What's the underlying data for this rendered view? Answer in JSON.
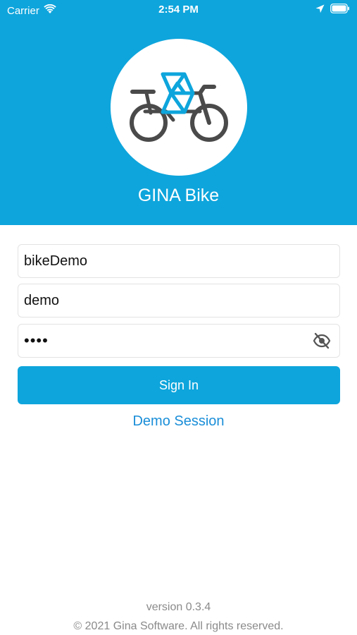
{
  "status_bar": {
    "carrier": "Carrier",
    "time": "2:54 PM"
  },
  "app": {
    "title": "GINA Bike"
  },
  "form": {
    "username_value": "bikeDemo",
    "second_value": "demo",
    "password_value": "demo"
  },
  "actions": {
    "sign_in_label": "Sign In",
    "demo_session_label": "Demo Session"
  },
  "footer": {
    "version": "version 0.3.4",
    "copyright": "© 2021 Gina Software. All rights reserved."
  },
  "colors": {
    "brand": "#0ea5dc",
    "link": "#1a8ed8",
    "logo_dark": "#4a4a4a"
  },
  "icons": {
    "wifi": "wifi-icon",
    "location": "location-arrow-icon",
    "battery": "battery-icon",
    "logo": "bike-logo-icon",
    "eye": "eye-slash-icon"
  }
}
